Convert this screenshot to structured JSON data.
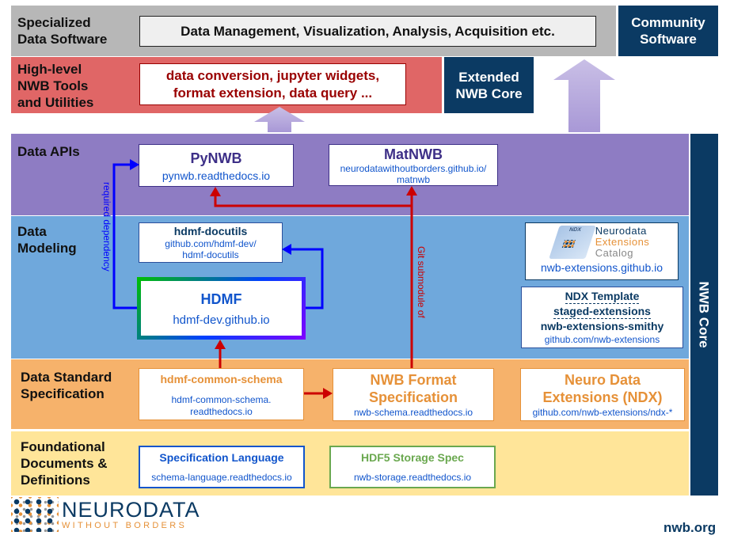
{
  "layers": {
    "specialized": {
      "label": "Specialized\nData Software",
      "box": "Data Management, Visualization, Analysis, Acquisition etc.",
      "color": "#b7b7b7"
    },
    "community": {
      "label": "Community\nSoftware",
      "color": "#0b3a63"
    },
    "tools": {
      "label": "High-level\nNWB Tools\nand Utilities",
      "box": "data conversion, jupyter widgets,\nformat extension, data query ...",
      "color": "#e06666"
    },
    "extended": {
      "label": "Extended\nNWB Core"
    },
    "apis": {
      "label": "Data APIs",
      "color": "#8e7cc3"
    },
    "modeling": {
      "label": "Data\nModeling",
      "color": "#6fa8dc"
    },
    "standard": {
      "label": "Data Standard\nSpecification",
      "color": "#f6b26b"
    },
    "foundational": {
      "label": "Foundational\nDocuments &\nDefinitions",
      "color": "#ffe599"
    },
    "nwb_core": {
      "label": "NWB Core"
    }
  },
  "nodes": {
    "pynwb": {
      "title": "PyNWB",
      "url": "pynwb.readthedocs.io"
    },
    "matnwb": {
      "title": "MatNWB",
      "url": "neurodatawithoutborders.github.io/\nmatnwb"
    },
    "docutils": {
      "title": "hdmf-docutils",
      "url": "github.com/hdmf-dev/\nhdmf-docutils"
    },
    "hdmf": {
      "title": "HDMF",
      "url": "hdmf-dev.github.io"
    },
    "catalog": {
      "logo_text": [
        "NDX",
        "Neurodata",
        "Extensions",
        "Catalog"
      ],
      "url": "nwb-extensions.github.io"
    },
    "template": {
      "lines": [
        "NDX Template",
        "staged-extensions",
        "nwb-extensions-smithy"
      ],
      "url": "github.com/nwb-extensions"
    },
    "common_schema": {
      "title": "hdmf-common-schema",
      "url": "hdmf-common-schema.\nreadthedocs.io"
    },
    "format_spec": {
      "title": "NWB Format\nSpecification",
      "url": "nwb-schema.readthedocs.io"
    },
    "ndx": {
      "title": "Neuro Data\nExtensions (NDX)",
      "url": "github.com/nwb-extensions/ndx-*"
    },
    "spec_language": {
      "title": "Specification Language",
      "url": "schema-language.readthedocs.io"
    },
    "hdf5_spec": {
      "title": "HDF5 Storage Spec",
      "url": "nwb-storage.readthedocs.io"
    }
  },
  "edges": {
    "required_dependency": "required dependency",
    "git_submodule": "Git submodule of"
  },
  "footer": {
    "logo_main": "NEURODATA",
    "logo_sub": "WITHOUT BORDERS",
    "site": "nwb.org"
  }
}
